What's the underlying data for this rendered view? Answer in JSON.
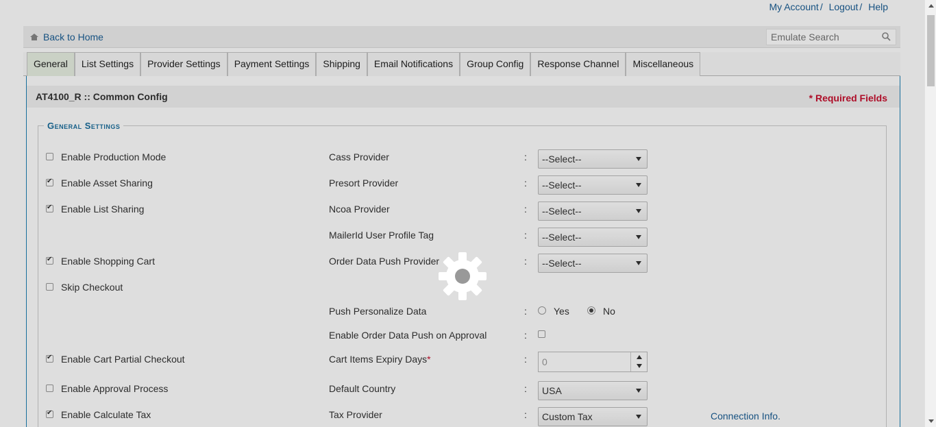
{
  "top_links": {
    "my_account": "My Account",
    "logout": "Logout",
    "help": "Help",
    "sep": "/"
  },
  "home_bar": {
    "back_home": "Back to Home",
    "search_placeholder": "Emulate Search"
  },
  "tabs": [
    "General",
    "List Settings",
    "Provider Settings",
    "Payment Settings",
    "Shipping",
    "Email Notifications",
    "Group Config",
    "Response Channel",
    "Miscellaneous"
  ],
  "active_tab": "General",
  "panel": {
    "title": "AT4100_R :: Common Config",
    "required_note": "* Required Fields"
  },
  "section": {
    "legend": "General Settings"
  },
  "left_options": [
    {
      "label": "Enable Production Mode",
      "checked": false
    },
    {
      "label": "Enable Asset Sharing",
      "checked": true
    },
    {
      "label": "Enable List Sharing",
      "checked": true
    },
    {
      "label": "Enable Shopping Cart",
      "checked": true
    },
    {
      "label": "Skip Checkout",
      "checked": false
    },
    {
      "label": "Enable Cart Partial Checkout",
      "checked": true
    },
    {
      "label": "Enable Approval Process",
      "checked": false
    },
    {
      "label": "Enable Calculate Tax",
      "checked": true
    }
  ],
  "right_fields": {
    "cass_provider": {
      "label": "Cass Provider",
      "value": "--Select--"
    },
    "presort_provider": {
      "label": "Presort Provider",
      "value": "--Select--"
    },
    "ncoa_provider": {
      "label": "Ncoa Provider",
      "value": "--Select--"
    },
    "mailerid_tag": {
      "label": "MailerId User Profile Tag",
      "value": "--Select--"
    },
    "order_push_provider": {
      "label": "Order Data Push Provider",
      "value": "--Select--"
    },
    "push_personalize": {
      "label": "Push Personalize Data",
      "yes": "Yes",
      "no": "No",
      "selected": "No"
    },
    "order_push_approval": {
      "label": "Enable Order Data Push on Approval",
      "checked": false
    },
    "cart_expiry": {
      "label": "Cart Items Expiry Days",
      "required_mark": "*",
      "value": "0"
    },
    "default_country": {
      "label": "Default Country",
      "value": "USA"
    },
    "tax_provider": {
      "label": "Tax Provider",
      "value": "Custom Tax",
      "link": "Connection Info."
    }
  },
  "colon": ":",
  "colors": {
    "accent": "#1a5e95",
    "required": "#c8102e",
    "panel_border": "#1a7fb3"
  }
}
